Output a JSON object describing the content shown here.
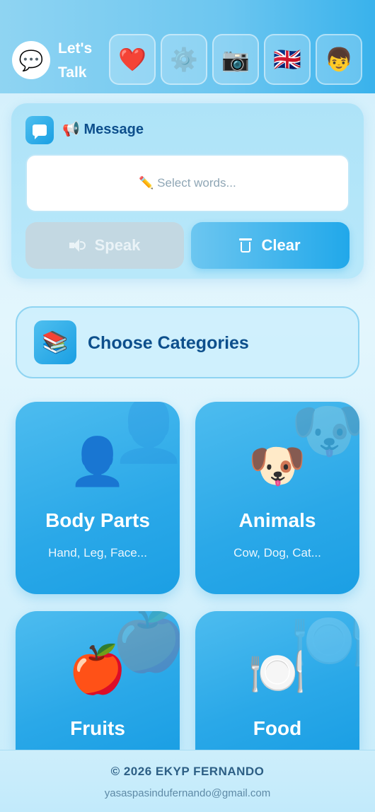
{
  "header": {
    "logo_icon": "💬",
    "title": "Let's Talk",
    "buttons": [
      {
        "name": "favorites",
        "icon": "❤️"
      },
      {
        "name": "settings",
        "icon": "⚙️"
      },
      {
        "name": "camera",
        "icon": "📷"
      },
      {
        "name": "language",
        "icon": "🇬🇧"
      },
      {
        "name": "profile",
        "icon": "👦"
      }
    ]
  },
  "message": {
    "title": "📢 Message",
    "placeholder": "✏️ Select words...",
    "speak_label": "Speak",
    "clear_label": "Clear"
  },
  "categories": {
    "header_icon": "📚",
    "header_title": "Choose Categories",
    "items": [
      {
        "icon": "👤",
        "title": "Body Parts",
        "subtitle": "Hand, Leg, Face..."
      },
      {
        "icon": "🐶",
        "title": "Animals",
        "subtitle": "Cow, Dog, Cat..."
      },
      {
        "icon": "🍎",
        "title": "Fruits",
        "subtitle": ""
      },
      {
        "icon": "🍽️",
        "title": "Food",
        "subtitle": ""
      }
    ]
  },
  "footer": {
    "copyright": "© 2026 EKYP FERNANDO",
    "email": "yasaspasindufernando@gmail.com"
  },
  "colors": {
    "accent": "#1a9fe3",
    "title_text": "#0d4f8c",
    "speak_disabled": "#c3d8e2"
  }
}
